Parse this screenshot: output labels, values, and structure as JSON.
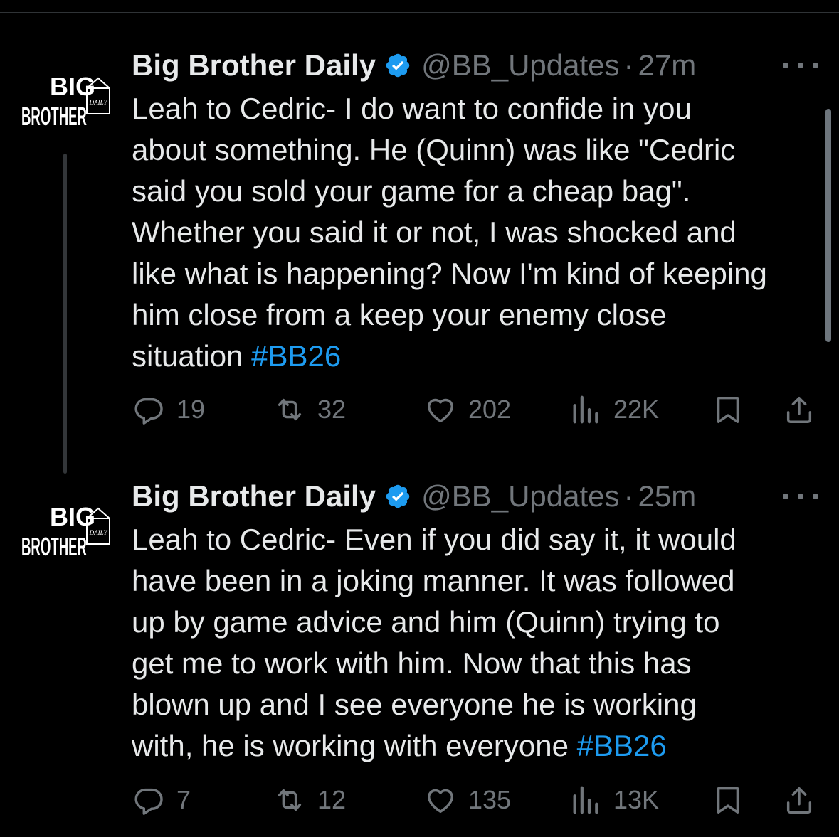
{
  "tweets": [
    {
      "author": {
        "name": "Big Brother Daily",
        "handle": "@BB_Updates",
        "logo_text": {
          "top": "BIG",
          "bottom": "BROTHER",
          "tag": "DAILY"
        }
      },
      "time": "27m",
      "text_lines": [
        "Leah to Cedric- I do want to confide in you",
        "about something. He (Quinn) was like \"Cedric",
        "said you sold your game for a cheap bag\".",
        "Whether you said it or not, I was shocked and",
        "like what is happening? Now I'm kind of keeping",
        "him close from a keep your enemy close",
        "situation"
      ],
      "hashtag": "#BB26",
      "stats": {
        "replies": "19",
        "retweets": "32",
        "likes": "202",
        "views": "22K"
      }
    },
    {
      "author": {
        "name": "Big Brother Daily",
        "handle": "@BB_Updates",
        "logo_text": {
          "top": "BIG",
          "bottom": "BROTHER",
          "tag": "DAILY"
        }
      },
      "time": "25m",
      "text_lines": [
        "Leah to Cedric- Even if you did say it, it would",
        "have been in a joking manner. It was followed",
        "up by game advice and him (Quinn) trying to",
        "get me to work with him. Now that this has",
        "blown up and I see everyone he is working",
        "with, he is working with everyone"
      ],
      "hashtag": "#BB26",
      "stats": {
        "replies": "7",
        "retweets": "12",
        "likes": "135",
        "views": "13K"
      }
    }
  ],
  "separator": "·",
  "colors": {
    "background": "#000000",
    "text": "#e7e9ea",
    "muted": "#71767b",
    "link": "#1d9bf0",
    "verified": "#1d9bf0"
  },
  "icons": [
    "reply-icon",
    "retweet-icon",
    "like-icon",
    "views-icon",
    "bookmark-icon",
    "share-icon",
    "verified-badge-icon",
    "more-icon"
  ]
}
